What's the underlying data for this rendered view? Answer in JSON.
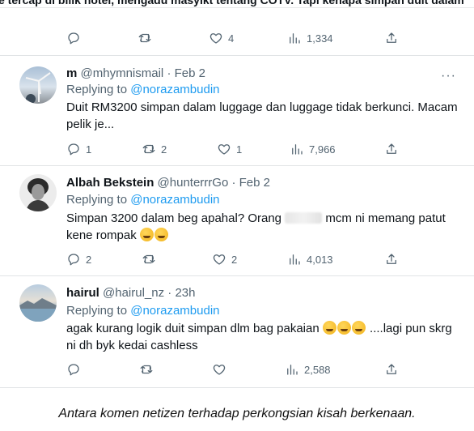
{
  "banner": {
    "text": "e tercap di bilik hotel, mengadu masyikt tentang COTV. Tapi kenapa simpan duit dalam"
  },
  "tweets": [
    {
      "partial": true,
      "actions": {
        "replies": "",
        "retweets": "",
        "likes": "4",
        "views": "1,334"
      }
    },
    {
      "display_name": "m",
      "handle": "@mhymnismail",
      "date": "· Feb 2",
      "replying_to_label": "Replying to",
      "replying_to": "@norazambudin",
      "body": "Duit RM3200 simpan dalam luggage dan luggage tidak berkunci. Macam pelik je...",
      "actions": {
        "replies": "1",
        "retweets": "2",
        "likes": "1",
        "views": "7,966"
      }
    },
    {
      "display_name": "Albah Bekstein",
      "handle": "@hunterrrGo",
      "date": "· Feb 2",
      "replying_to_label": "Replying to",
      "replying_to": "@norazambudin",
      "body_part1": "Simpan 3200 dalam beg apahal? Orang",
      "body_part2": "mcm ni memang patut kene rompak",
      "actions": {
        "replies": "2",
        "retweets": "",
        "likes": "2",
        "views": "4,013"
      }
    },
    {
      "display_name": "hairul",
      "handle": "@hairul_nz",
      "date": "· 23h",
      "replying_to_label": "Replying to",
      "replying_to": "@norazambudin",
      "body_part1": "agak kurang logik duit simpan dlm bag pakaian",
      "body_part2": "....lagi pun skrg ni dh byk kedai cashless",
      "actions": {
        "replies": "",
        "retweets": "",
        "likes": "",
        "views": "2,588"
      }
    }
  ],
  "more_label": "···",
  "caption": "Antara komen netizen terhadap perkongsian kisah berkenaan."
}
